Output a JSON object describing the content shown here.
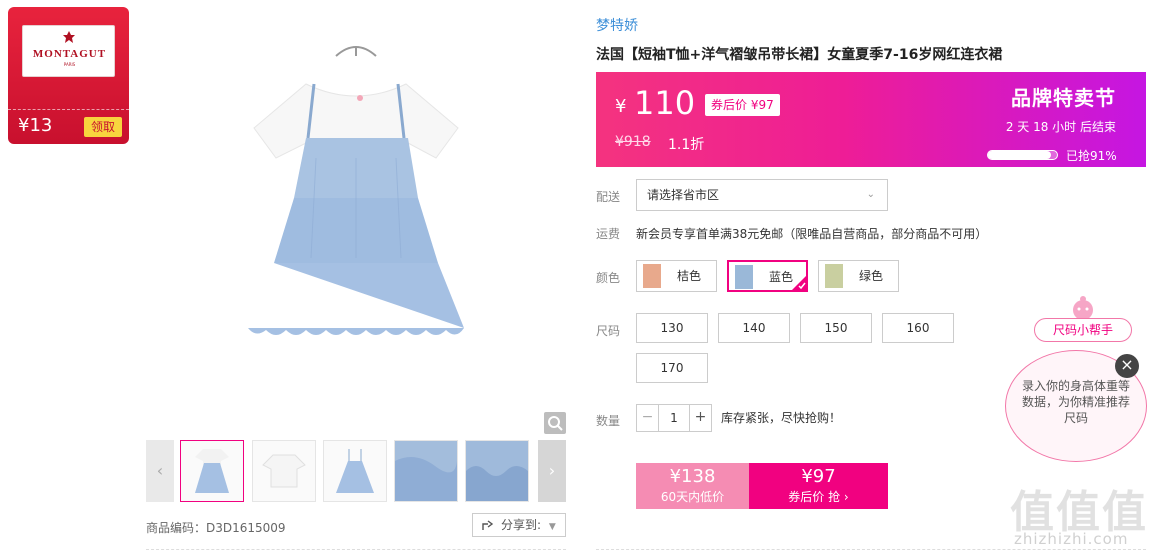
{
  "coupon": {
    "brand": "MONTAGUT",
    "brand_sub": "PARIS",
    "amount": "¥13",
    "get_label": "领取"
  },
  "product": {
    "brand": "梦特娇",
    "title": "法国【短袖T恤+洋气褶皱吊带长裙】女童夏季7-16岁网红连衣裙",
    "sku_code": "商品编码：D3D1615009",
    "share_label": "分享到:"
  },
  "price": {
    "yen": "¥",
    "current": "110",
    "after_coupon": "券后价 ¥97",
    "original": "¥918",
    "discount": "1.1折",
    "event_title": "品牌特卖节",
    "countdown": "2  天  18  小时  后结束",
    "sold_fraction": 0.91,
    "sold_label": "已抢91%"
  },
  "delivery": {
    "label": "配送",
    "placeholder": "请选择省市区"
  },
  "shipping": {
    "label": "运费",
    "text": "新会员专享首单满38元免邮（限唯品自营商品，部分商品不可用）"
  },
  "colors": {
    "label": "颜色",
    "options": [
      {
        "name": "桔色",
        "swatch": "#e8a98c"
      },
      {
        "name": "蓝色",
        "swatch": "#9ab8d8"
      },
      {
        "name": "绿色",
        "swatch": "#c9cfa0"
      }
    ],
    "selected": "蓝色"
  },
  "sizes": {
    "label": "尺码",
    "options": [
      "130",
      "140",
      "150",
      "160",
      "170"
    ]
  },
  "quantity": {
    "label": "数量",
    "minus": "−",
    "value": "1",
    "plus": "+",
    "note": "库存紧张，尽快抢购！"
  },
  "buy": {
    "normal_price": "¥138",
    "normal_sub": "60天内低价",
    "coupon_price": "¥97",
    "coupon_sub": "券后价 抢 ›"
  },
  "size_helper": {
    "tag": "尺码小帮手",
    "text": "录入你的身高体重等数据，为你精准推荐尺码",
    "close": "×"
  },
  "watermark": {
    "big": "值值值",
    "small": "zhizhizhi.com"
  },
  "theme": {
    "accent": "#f10180",
    "coupon_red": "#c8102e"
  }
}
